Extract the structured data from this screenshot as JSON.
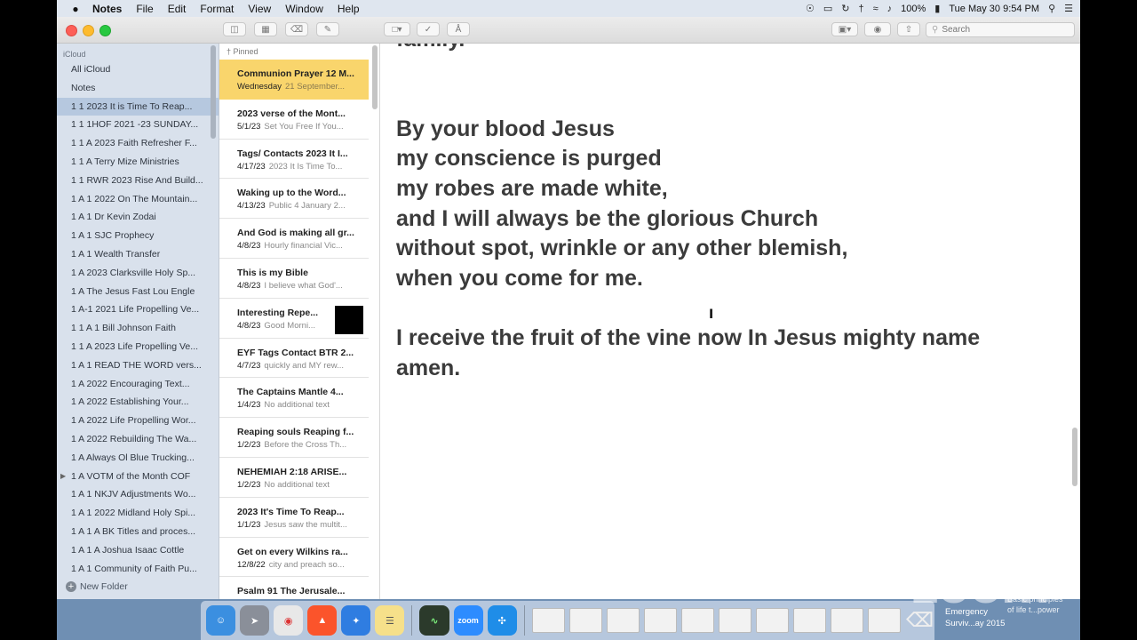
{
  "menubar": {
    "app_name": "Notes",
    "menus": [
      "File",
      "Edit",
      "Format",
      "View",
      "Window",
      "Help"
    ],
    "battery": "100%",
    "clock": "Tue May 30  9:54 PM"
  },
  "toolbar": {
    "search_placeholder": "Search"
  },
  "sidebar": {
    "account": "iCloud",
    "items": [
      {
        "label": "All iCloud"
      },
      {
        "label": "Notes"
      },
      {
        "label": "1  1  2023 It is Time To Reap..."
      },
      {
        "label": "1  1   1HOF 2021 -23 SUNDAY..."
      },
      {
        "label": "1 1 A  2023 Faith Refresher F..."
      },
      {
        "label": "1 1 A Terry Mize Ministries"
      },
      {
        "label": "1 1 RWR 2023 Rise And Build..."
      },
      {
        "label": "1  A  1 2022 On The Mountain..."
      },
      {
        "label": "1  A  1 Dr Kevin Zodai"
      },
      {
        "label": "1  A  1 SJC Prophecy"
      },
      {
        "label": "1  A  1 Wealth Transfer"
      },
      {
        "label": "1  A  2023 Clarksville Holy Sp..."
      },
      {
        "label": "1  A  The Jesus Fast Lou Engle"
      },
      {
        "label": "1  A-1 2021 Life Propelling Ve..."
      },
      {
        "label": "1 1 A  1 Bill Johnson Faith"
      },
      {
        "label": "1 1 A 2023 Life Propelling  Ve..."
      },
      {
        "label": "1  A  1 READ THE WORD  vers..."
      },
      {
        "label": "1  A   2022 Encouraging Text..."
      },
      {
        "label": "1  A   2022 Establishing Your..."
      },
      {
        "label": "1  A   2022 Life Propelling Wor..."
      },
      {
        "label": "1  A   2022 Rebuilding The Wa..."
      },
      {
        "label": "1  A   Always Ol Blue Trucking..."
      },
      {
        "label": "1 A   VOTM of the Month COF"
      },
      {
        "label": "1 A  1   NKJV Adjustments Wo..."
      },
      {
        "label": "1 A  1  2022 Midland Holy Spi..."
      },
      {
        "label": "1 A  1  A BK Titles and proces..."
      },
      {
        "label": "1 A  1  A Joshua Isaac Cottle"
      },
      {
        "label": "1 A  1  Community of Faith Pu..."
      }
    ],
    "new_folder": "New Folder"
  },
  "notelist": {
    "pinned_label": "Pinned",
    "notes": [
      {
        "title": "Communion Prayer 12 M...",
        "date": "Wednesday",
        "preview": "21 September..."
      },
      {
        "title": "2023 verse of the Mont...",
        "date": "5/1/23",
        "preview": "Set You Free If You..."
      },
      {
        "title": "Tags/ Contacts 2023 It I...",
        "date": "4/17/23",
        "preview": "2023 It Is Time To..."
      },
      {
        "title": "Waking up to the Word...",
        "date": "4/13/23",
        "preview": "Public 4 January 2..."
      },
      {
        "title": "And God is making all gr...",
        "date": "4/8/23",
        "preview": "Hourly financial Vic..."
      },
      {
        "title": "This is my Bible",
        "date": "4/8/23",
        "preview": "I believe what God'..."
      },
      {
        "title": "Interesting Repe...",
        "date": "4/8/23",
        "preview": "Good Morni..."
      },
      {
        "title": "EYF Tags Contact BTR 2...",
        "date": "4/7/23",
        "preview": "quickly and MY rew..."
      },
      {
        "title": "The Captains Mantle 4...",
        "date": "1/4/23",
        "preview": "No additional text"
      },
      {
        "title": "Reaping souls Reaping f...",
        "date": "1/2/23",
        "preview": "Before the Cross Th..."
      },
      {
        "title": "NEHEMIAH 2:18 ARISE...",
        "date": "1/2/23",
        "preview": "No additional text"
      },
      {
        "title": "2023 It's Time To Reap...",
        "date": "1/1/23",
        "preview": "Jesus saw the multit..."
      },
      {
        "title": "Get on every Wilkins ra...",
        "date": "12/8/22",
        "preview": "city and preach so..."
      },
      {
        "title": "Psalm 91 The Jerusale...",
        "date": "",
        "preview": ""
      }
    ]
  },
  "editor": {
    "lines": [
      "family.",
      "",
      "",
      "By your blood Jesus",
      "my conscience is purged",
      "my robes are made white,",
      "and I will always be the glorious Church",
      "without spot, wrinkle or any other blemish,",
      "when you come for me.",
      "",
      "I receive the fruit of the vine now In Jesus mighty name",
      "amen."
    ]
  },
  "dock": {
    "zoom_label": "zoom",
    "item_label_1": "Emergency",
    "item_label_2": "Surviv...ay 2015",
    "item_label_3": "Basic principles",
    "item_label_4": "of life t...power"
  },
  "watermark": "zoom",
  "colors": {
    "selected_note": "#f9d56c",
    "sidebar_bg": "#d9e1ec",
    "sidebar_selected": "#b6c8df"
  }
}
